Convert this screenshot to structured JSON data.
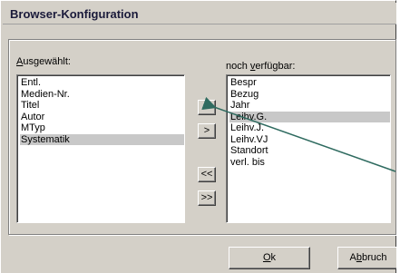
{
  "window": {
    "title": "Browser-Konfiguration"
  },
  "selected_list": {
    "label_prefix": "A",
    "label_rest": "usgewählt:",
    "items": [
      "Entl.",
      "Medien-Nr.",
      "Titel",
      "Autor",
      "MTyp",
      "Systematik"
    ],
    "highlighted_index": 5
  },
  "available_list": {
    "label_prefix": "noch ",
    "label_underlined": "v",
    "label_rest": "erfügbar:",
    "items": [
      "Bespr",
      "Bezug",
      "Jahr",
      "Leihv.G.",
      "Leihv.J.",
      "Leihv.VJ",
      "Standort",
      "verl. bis"
    ],
    "highlighted_index": 3
  },
  "transfer_buttons": {
    "add_one": "<",
    "remove_one": ">",
    "add_all": "<<",
    "remove_all": ">>"
  },
  "footer": {
    "ok_underlined": "O",
    "ok_rest": "k",
    "cancel_prefix": "A",
    "cancel_underlined": "b",
    "cancel_rest": "bruch"
  }
}
